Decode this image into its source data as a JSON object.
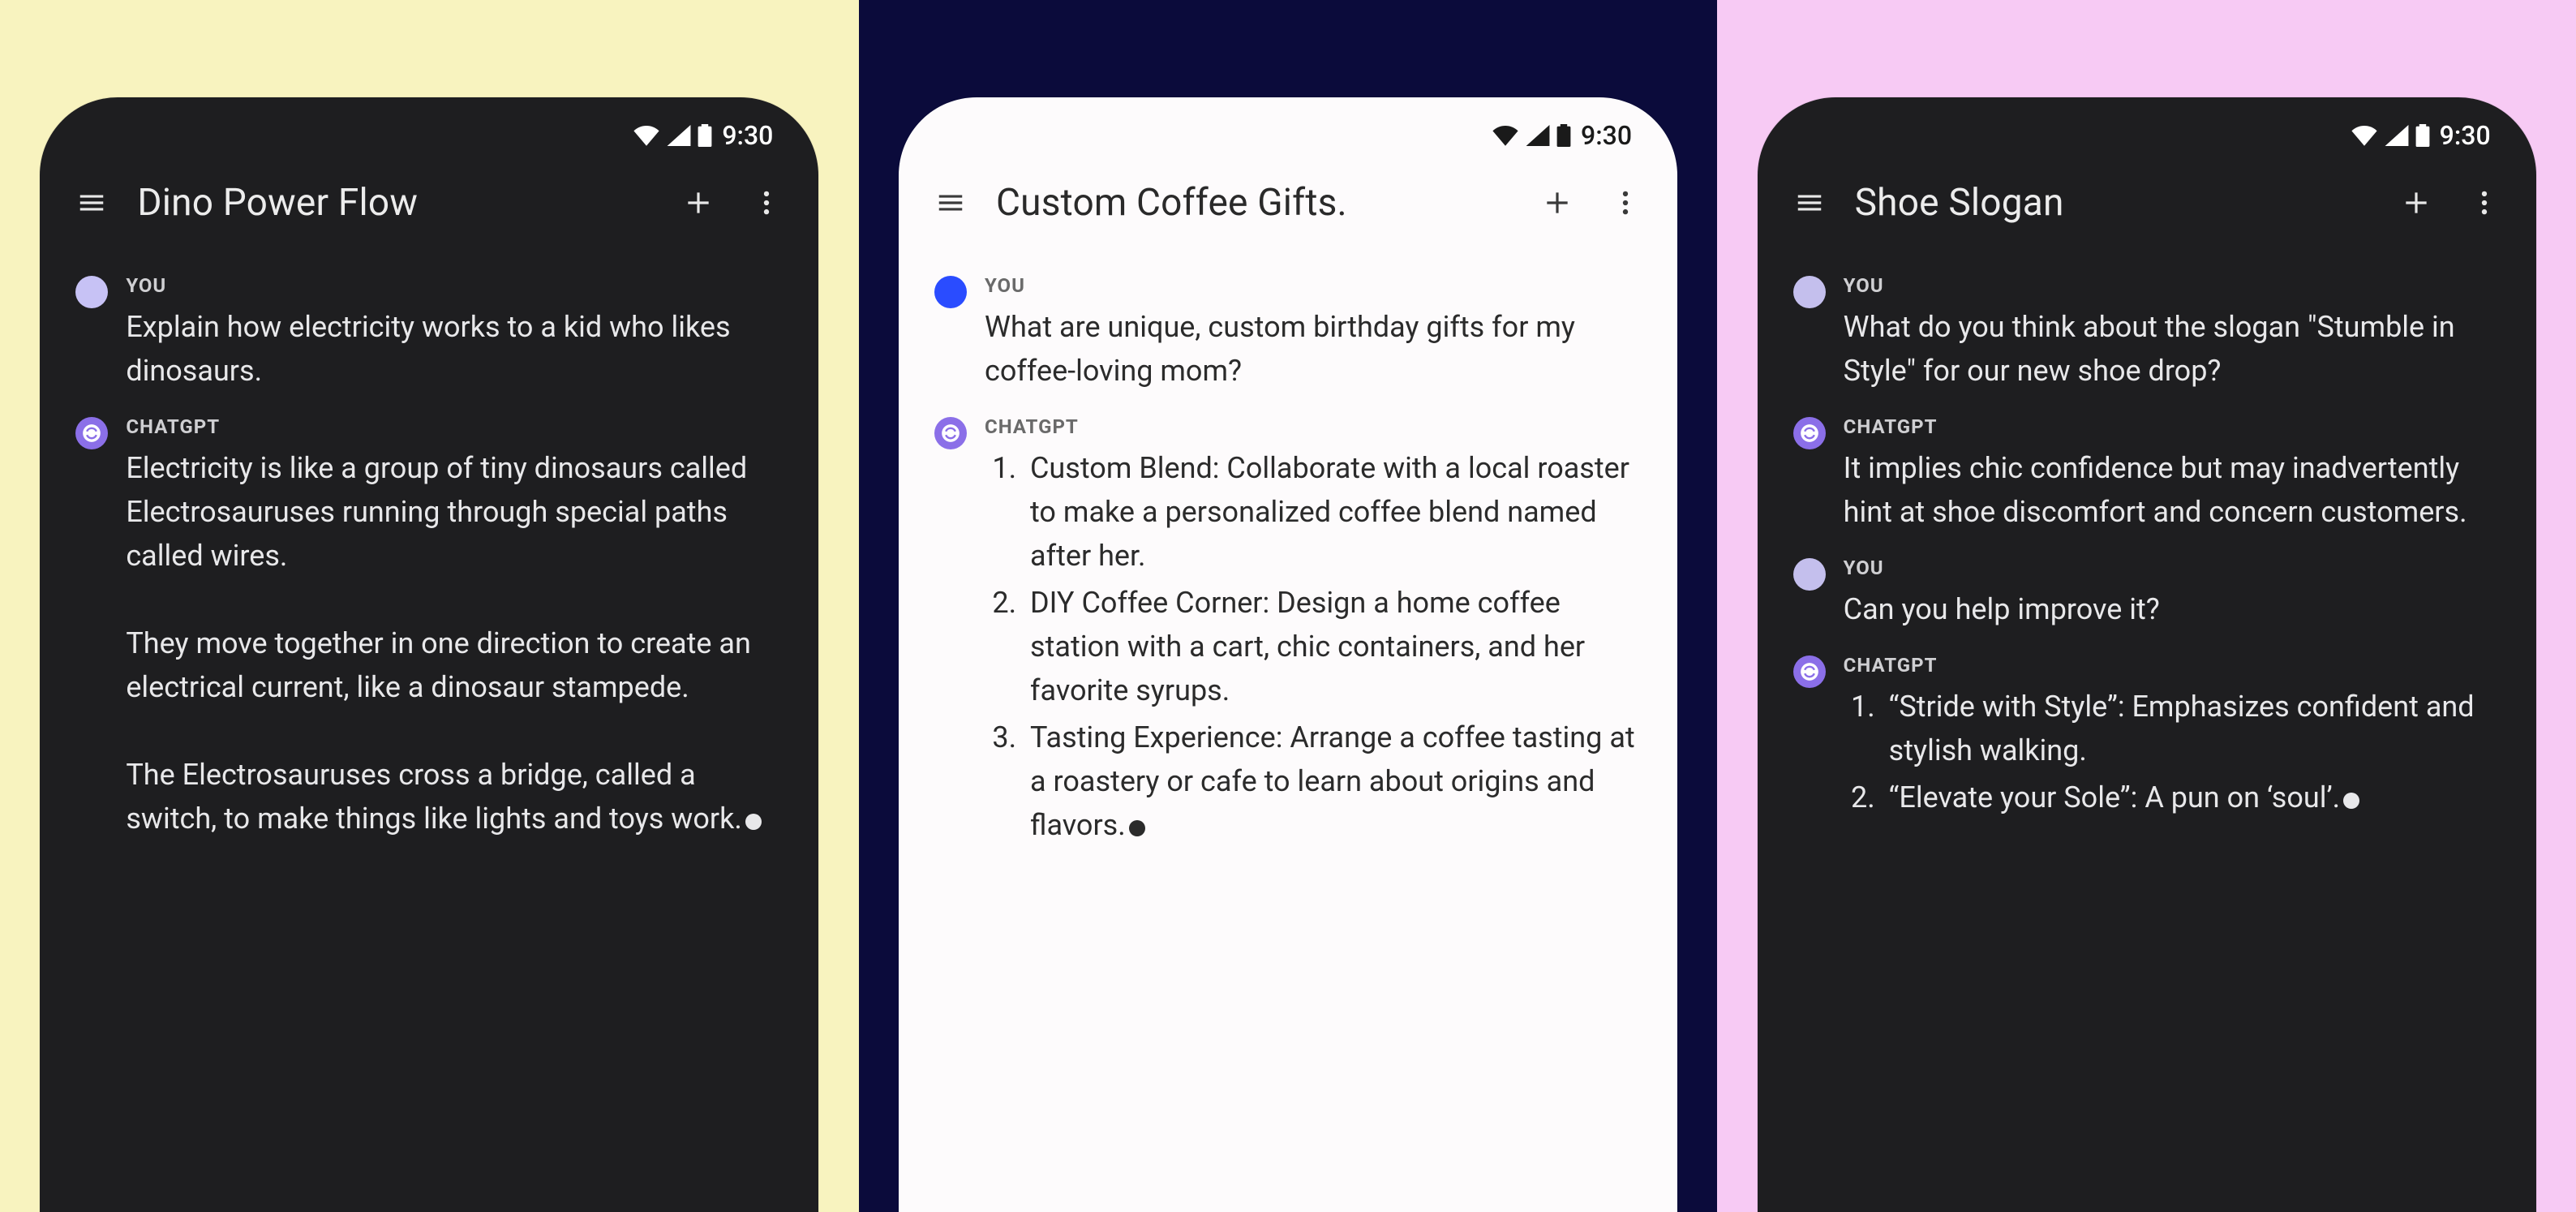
{
  "status_time": "9:30",
  "labels": {
    "you": "YOU",
    "assistant": "CHATGPT"
  },
  "phones": [
    {
      "title": "Dino Power Flow",
      "messages": {
        "m0_text": "Explain how electricity works to a kid who likes dinosaurs.",
        "m1_text": "Electricity is like a group of tiny dinosaurs called Electrosauruses running through special paths called wires.\n\nThey move together in one direction to create an electrical current, like a dinosaur stampede.\n\nThe Electrosauruses cross a bridge, called a switch, to make things like lights and toys work."
      }
    },
    {
      "title": "Custom Coffee Gifts.",
      "messages": {
        "m0_text": "What are unique, custom birthday gifts for my coffee-loving mom?",
        "m1_items": {
          "i1": "Custom Blend: Collaborate with a local roaster to make a personalized coffee blend named after her.",
          "i2": "DIY Coffee Corner: Design a home coffee station with a cart, chic containers, and her favorite syrups.",
          "i3": "Tasting Experience: Arrange a coffee tasting at a roastery or cafe to learn about origins and flavors."
        }
      }
    },
    {
      "title": "Shoe Slogan",
      "messages": {
        "m0_text": "What do you think about the slogan \"Stumble in Style\" for our new shoe drop?",
        "m1_text": "It implies chic confidence but may inadvertently hint at shoe discomfort and concern customers.",
        "m2_text": "Can you help improve it?",
        "m3_items": {
          "i1": "“Stride with Style”: Emphasizes confident and stylish walking.",
          "i2": "“Elevate your Sole”: A pun on ‘soul’."
        }
      }
    }
  ]
}
